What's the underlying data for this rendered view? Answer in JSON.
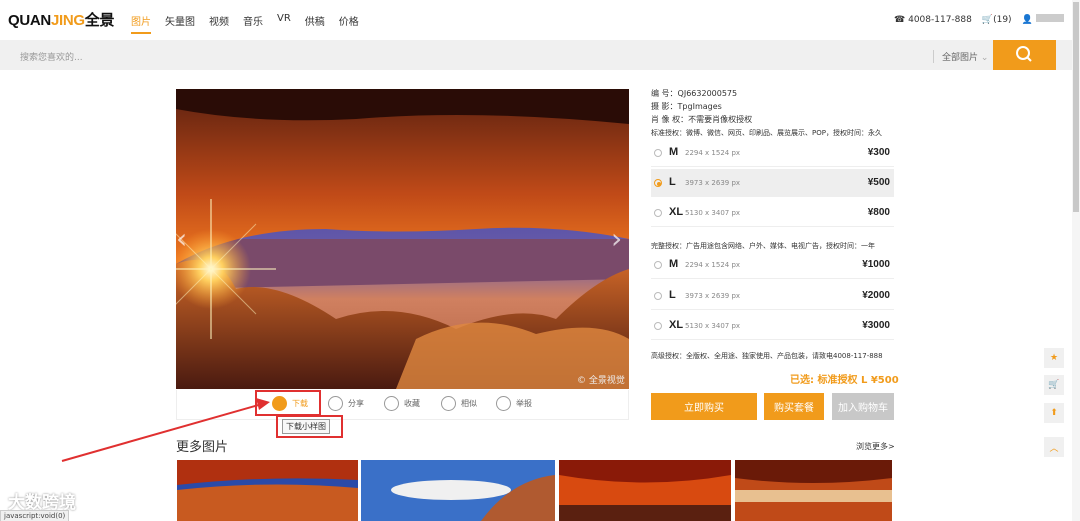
{
  "logo": {
    "part1": "QUAN",
    "part2": "JING",
    "part3": "全景"
  },
  "nav": [
    "图片",
    "矢量图",
    "视频",
    "音乐",
    "VR",
    "供稿",
    "价格"
  ],
  "topright": {
    "phone": "4008-117-888",
    "cart": "(19)"
  },
  "search": {
    "placeholder": "搜索您喜欢的...",
    "scope": "全部图片"
  },
  "photo": {
    "watermark": "© 全景视觉",
    "prev": "‹",
    "next": "›"
  },
  "actions": {
    "download": "下载",
    "share": "分享",
    "favorite": "收藏",
    "similar": "相似",
    "report": "举报",
    "tooltip": "下载小样图"
  },
  "more": {
    "title": "更多图片",
    "link": "浏览更多>"
  },
  "info": {
    "id_label": "编    号：",
    "id": "QJ6632000575",
    "author_label": "摄    影：",
    "author": "TpgImages",
    "portrait_label": "肖 像 权：",
    "portrait": "不需要肖像权授权"
  },
  "standard": {
    "desc": "标准授权：微博、微信、网页、印刷品、展览展示、POP，授权时间：永久",
    "options": [
      {
        "size": "M",
        "px": "2294 x 1524 px",
        "price": "¥300"
      },
      {
        "size": "L",
        "px": "3973 x 2639 px",
        "price": "¥500"
      },
      {
        "size": "XL",
        "px": "5130 x 3407 px",
        "price": "¥800"
      }
    ]
  },
  "full": {
    "desc": "完整授权：广告用途包含网络、户外、媒体、电视广告，授权时间：一年",
    "options": [
      {
        "size": "M",
        "px": "2294 x 1524 px",
        "price": "¥1000"
      },
      {
        "size": "L",
        "px": "3973 x 2639 px",
        "price": "¥2000"
      },
      {
        "size": "XL",
        "px": "5130 x 3407 px",
        "price": "¥3000"
      }
    ]
  },
  "advanced": "高级授权：全版权、全用途、独家使用、产品包装，请致电4008-117-888",
  "selected": "已选: 标准授权   L ¥500",
  "buttons": {
    "buy": "立即购买",
    "package": "购买套餐",
    "cart": "加入购物车"
  },
  "statusbar": "javascript:void(0)",
  "brand_wm": "大数跨境",
  "colors": {
    "accent": "#f19b1b",
    "annotation": "#e03030"
  }
}
